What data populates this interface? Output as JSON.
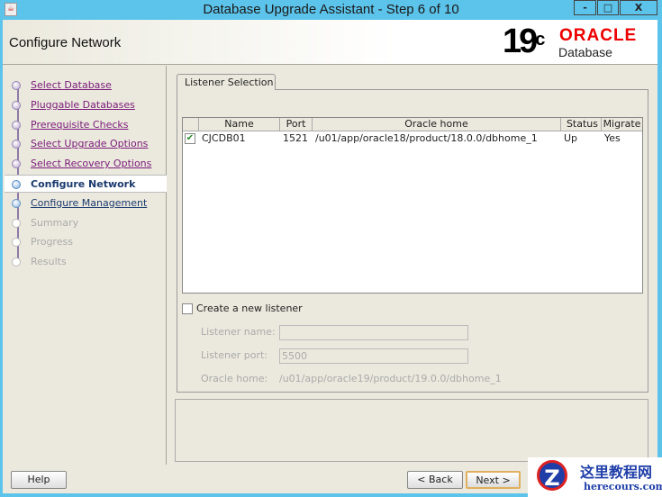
{
  "window": {
    "title": "Database Upgrade Assistant - Step 6 of 10",
    "minimize": "-",
    "maximize": "□",
    "close": "X"
  },
  "header": {
    "title": "Configure Network",
    "logo_version": "19",
    "logo_sup": "c",
    "logo_brand": "ORACLE",
    "logo_product": "Database"
  },
  "steps": [
    {
      "label": "Select Database",
      "state": "done"
    },
    {
      "label": "Pluggable Databases",
      "state": "done"
    },
    {
      "label": "Prerequisite Checks",
      "state": "done"
    },
    {
      "label": "Select Upgrade Options",
      "state": "done"
    },
    {
      "label": "Select Recovery Options",
      "state": "done"
    },
    {
      "label": "Configure Network",
      "state": "current"
    },
    {
      "label": "Configure Management",
      "state": "next"
    },
    {
      "label": "Summary",
      "state": "disabled"
    },
    {
      "label": "Progress",
      "state": "disabled"
    },
    {
      "label": "Results",
      "state": "disabled"
    }
  ],
  "tab": {
    "label": "Listener Selection"
  },
  "table": {
    "columns": [
      "Name",
      "Port",
      "Oracle home",
      "Status",
      "Migrate"
    ],
    "rows": [
      {
        "checked": true,
        "name": "CJCDB01",
        "port": "1521",
        "home": "/u01/app/oracle18/product/18.0.0/dbhome_1",
        "status": "Up",
        "migrate": "Yes"
      }
    ]
  },
  "new_listener": {
    "checkbox_label": "Create a new listener",
    "checked": false,
    "name_label": "Listener name:",
    "name_value": "",
    "port_label": "Listener port:",
    "port_value": "5500",
    "home_label": "Oracle home:",
    "home_value": "/u01/app/oracle19/product/19.0.0/dbhome_1"
  },
  "buttons": {
    "help": "Help",
    "back": "< Back",
    "next": "Next >"
  },
  "watermark": {
    "cn": "这里教程网",
    "en": "herecours.com"
  }
}
